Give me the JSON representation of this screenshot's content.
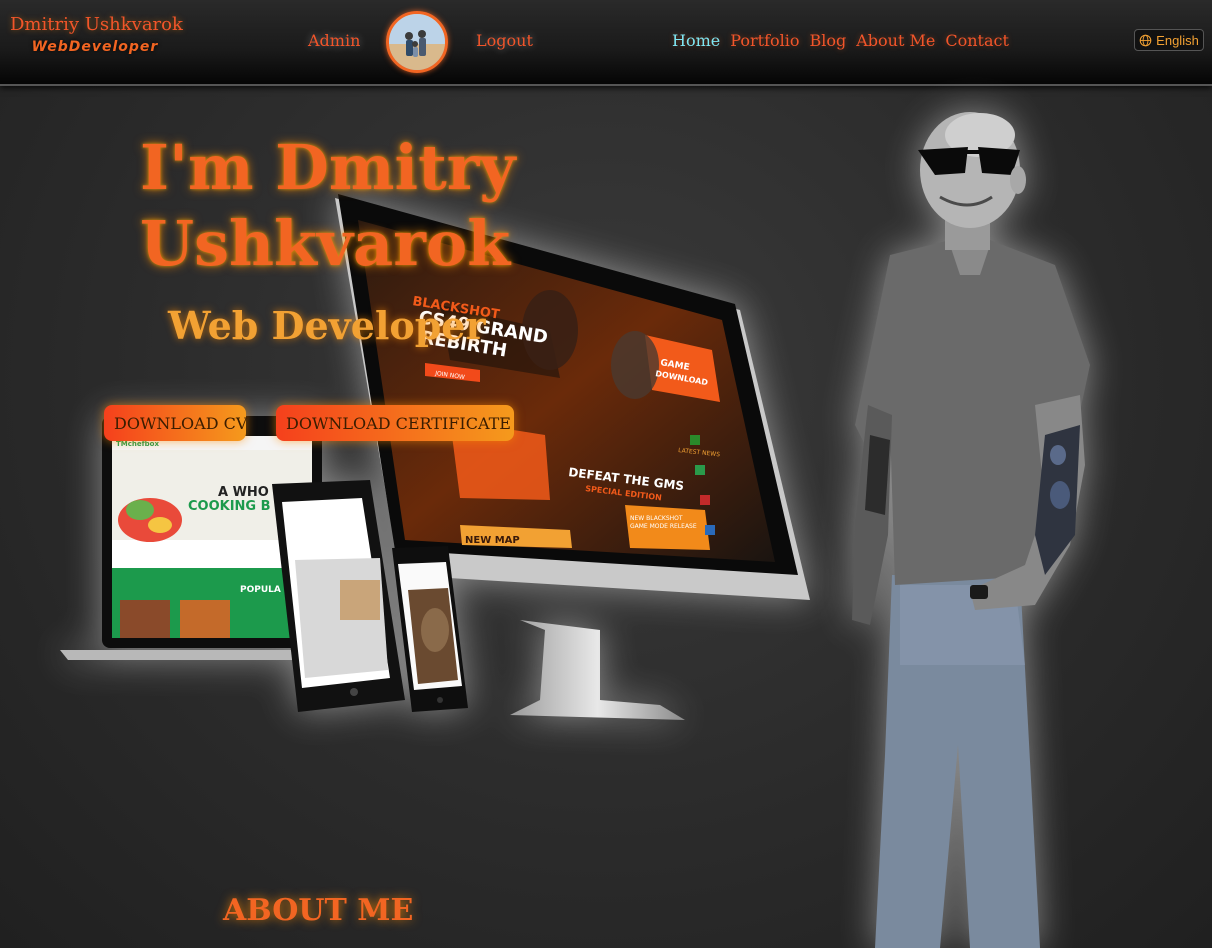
{
  "brand": {
    "name": "Dmitriy Ushkvarok",
    "role": "WebDeveloper"
  },
  "header": {
    "admin_label": "Admin",
    "logout_label": "Logout",
    "nav": [
      {
        "label": "Home",
        "active": true
      },
      {
        "label": "Portfolio",
        "active": false
      },
      {
        "label": "Blog",
        "active": false
      },
      {
        "label": "About Me",
        "active": false
      },
      {
        "label": "Contact",
        "active": false
      }
    ],
    "language": {
      "icon": "globe-icon",
      "label": "English"
    }
  },
  "hero": {
    "title_line1": "I'm Dmitry",
    "title_line2": "Ushkvarok",
    "subtitle": "Web Developer",
    "download_cv_label": "DOWNLOAD CV",
    "download_certificate_label": "DOWNLOAD CERTIFICATE"
  },
  "monitor": {
    "game_brand": "BLACKSHOT",
    "headline_line1": "CS49 GRAND",
    "headline_line2": "REBIRTH",
    "join_label": "JOIN NOW",
    "game_download_line1": "GAME",
    "game_download_line2": "DOWNLOAD",
    "defeat_line1": "DEFEAT THE GMS",
    "defeat_line2": "SPECIAL EDITION",
    "new_map": "NEW MAP",
    "latest_news": "LATEST NEWS",
    "release_line1": "NEW BLACKSHOT",
    "release_line2": "GAME MODE RELEASE"
  },
  "laptop": {
    "site_name": "TMchefbox",
    "headline_line1": "A WHO",
    "headline_line2": "COOKING B",
    "popular": "POPULA"
  },
  "sections": {
    "about_heading": "ABOUT ME"
  },
  "colors": {
    "accent": "#f26522",
    "accent_light": "#f2a133",
    "nav_active": "#7fe6f2",
    "background": "#2b2b2b"
  }
}
